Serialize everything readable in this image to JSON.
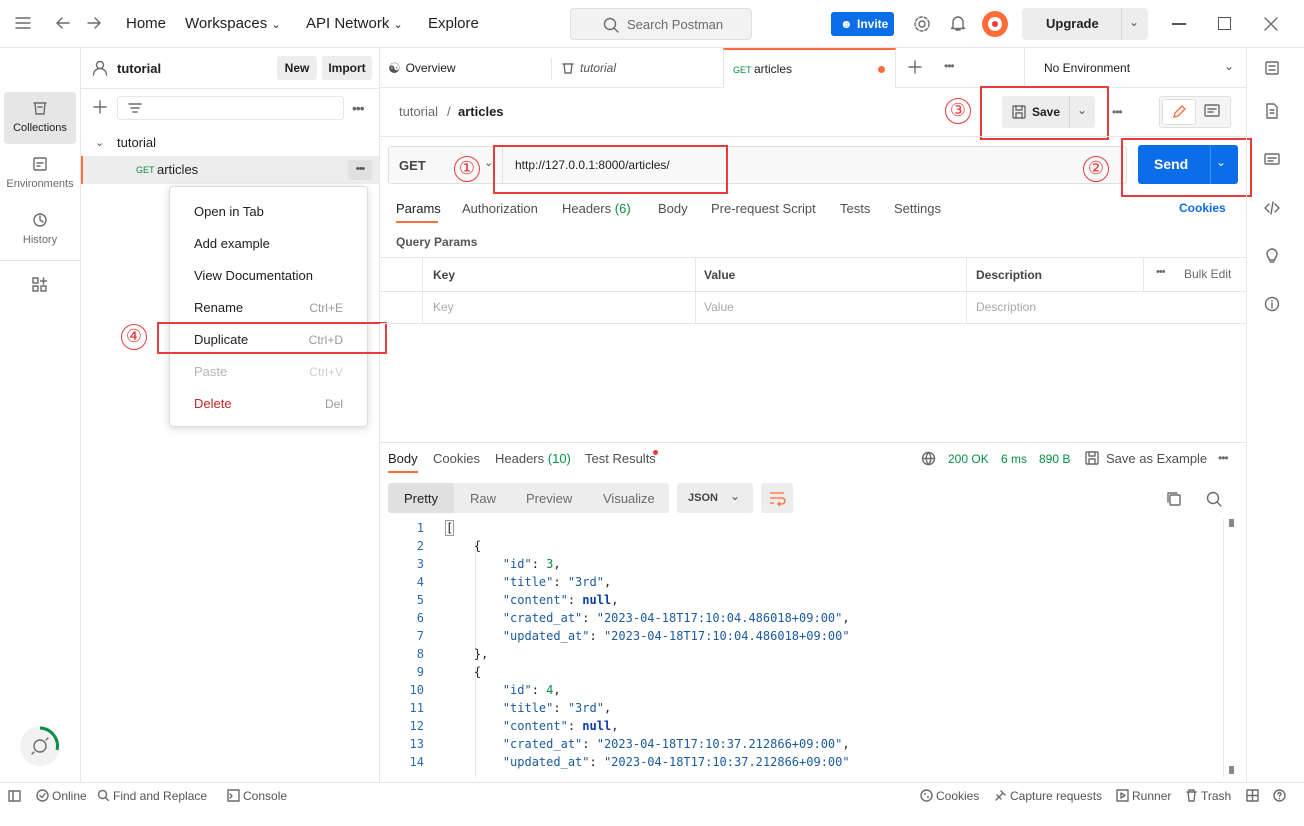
{
  "nav": {
    "home": "Home",
    "workspaces": "Workspaces",
    "api_network": "API Network",
    "explore": "Explore"
  },
  "search": {
    "placeholder": "Search Postman"
  },
  "invite": "Invite",
  "upgrade": "Upgrade",
  "sidebar": {
    "workspace": "tutorial",
    "new": "New",
    "import": "Import",
    "collection": "tutorial",
    "request": {
      "method": "GET",
      "name": "articles"
    }
  },
  "rail": {
    "collections": "Collections",
    "environments": "Environments",
    "history": "History"
  },
  "context_menu": [
    {
      "label": "Open in Tab",
      "shortcut": ""
    },
    {
      "label": "Add example",
      "shortcut": ""
    },
    {
      "label": "View Documentation",
      "shortcut": ""
    },
    {
      "label": "Rename",
      "shortcut": "Ctrl+E"
    },
    {
      "label": "Duplicate",
      "shortcut": "Ctrl+D"
    },
    {
      "label": "Paste",
      "shortcut": "Ctrl+V"
    },
    {
      "label": "Delete",
      "shortcut": "Del"
    }
  ],
  "tabs": {
    "overview": "Overview",
    "tutorial": "tutorial",
    "articles_method": "GET",
    "articles": "articles",
    "env": "No Environment"
  },
  "breadcrumb": {
    "collection": "tutorial",
    "sep": "/",
    "request": "articles"
  },
  "save": "Save",
  "request": {
    "method": "GET",
    "url": "http://127.0.0.1:8000/articles/",
    "send": "Send"
  },
  "req_tabs": {
    "params": "Params",
    "auth": "Authorization",
    "headers": "Headers",
    "headers_count": "(6)",
    "body": "Body",
    "prereq": "Pre-request Script",
    "tests": "Tests",
    "settings": "Settings",
    "cookies": "Cookies"
  },
  "query_params": {
    "title": "Query Params",
    "key": "Key",
    "value": "Value",
    "description": "Description",
    "bulk_edit": "Bulk Edit",
    "ph_key": "Key",
    "ph_value": "Value",
    "ph_description": "Description"
  },
  "resp_tabs": {
    "body": "Body",
    "cookies": "Cookies",
    "headers": "Headers",
    "headers_count": "(10)",
    "test_results": "Test Results"
  },
  "resp_meta": {
    "status": "200 OK",
    "time": "6 ms",
    "size": "890 B",
    "save_example": "Save as Example"
  },
  "resp_view": {
    "pretty": "Pretty",
    "raw": "Raw",
    "preview": "Preview",
    "visualize": "Visualize",
    "format": "JSON"
  },
  "code_lines": [
    "1",
    "2",
    "3",
    "4",
    "5",
    "6",
    "7",
    "8",
    "9",
    "10",
    "11",
    "12",
    "13",
    "14"
  ],
  "annotations": {
    "n1": "①",
    "n2": "②",
    "n3": "③",
    "n4": "④"
  },
  "status": {
    "online": "Online",
    "find_replace": "Find and Replace",
    "console": "Console",
    "cookies": "Cookies",
    "capture": "Capture requests",
    "runner": "Runner",
    "trash": "Trash"
  },
  "colors": {
    "accent": "#ff6c37",
    "send": "#0b6ee8",
    "annot": "#e63c3c",
    "ok": "#0a8d44"
  }
}
